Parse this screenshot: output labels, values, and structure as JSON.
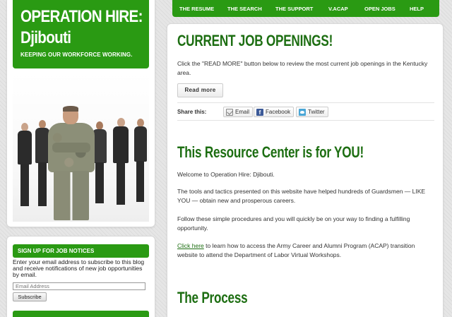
{
  "site": {
    "title_line1": "OPERATION HIRE:",
    "title_line2": "Djibouti",
    "tagline": "KEEPING OUR WORKFORCE WORKING."
  },
  "nav": {
    "items": [
      {
        "label": "THE RESUME"
      },
      {
        "label": "THE SEARCH"
      },
      {
        "label": "THE SUPPORT"
      },
      {
        "label": "V.ACAP"
      },
      {
        "label": "OPEN JOBS"
      },
      {
        "label": "HELP"
      }
    ]
  },
  "jobs": {
    "heading": "CURRENT JOB OPENINGS!",
    "text": "Click the \"READ MORE\" button below to review the most current job openings in the Kentucky area.",
    "button": "Read more"
  },
  "share": {
    "label": "Share this:",
    "email": "Email",
    "facebook": "Facebook",
    "twitter": "Twitter"
  },
  "resource": {
    "heading": "This Resource Center is for YOU!",
    "p1": "Welcome to Operation Hire: Djibouti.",
    "p2": "The tools and tactics presented on this website have helped hundreds of Guardsmen — LIKE YOU — obtain new and prosperous careers.",
    "p3": "Follow these simple procedures and you will quickly be on your way to finding a fulfilling opportunity.",
    "p4_link": "Click here",
    "p4_rest": " to learn how to access the Army Career and Alumni Program (ACAP) transition website to attend the Department of Labor Virtual Workshops."
  },
  "process": {
    "heading": "The Process"
  },
  "signup": {
    "heading": "SIGN UP FOR JOB NOTICES",
    "text": "Enter your email address to subscribe to this blog and receive notifications of new job opportunities by email.",
    "placeholder": "Email Address",
    "button": "Subscribe"
  },
  "colors": {
    "brand_green": "#2a9a13",
    "heading_green": "#1d6e12"
  }
}
